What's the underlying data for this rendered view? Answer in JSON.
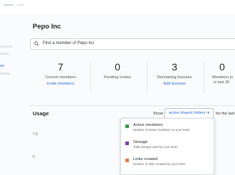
{
  "sidebar": {
    "link_fragment": "on"
  },
  "org": {
    "name": "Pepo Inc"
  },
  "search": {
    "placeholder": "Find a member of Pepo Inc"
  },
  "stats": [
    {
      "number": "7",
      "label": "Current members",
      "link": "Invite members"
    },
    {
      "number": "0",
      "label": "Pending invites",
      "link": ""
    },
    {
      "number": "3",
      "label": "Remaining licenses",
      "link": "Add licenses"
    },
    {
      "number": "0",
      "label": "Members jo",
      "link": "in last 30"
    }
  ],
  "usage": {
    "title": "Usage",
    "show_label": "Show",
    "selected": "active shared folders",
    "period_label": "for the last",
    "y_ticks": [
      "7.5",
      "5"
    ]
  },
  "dropdown": {
    "options": [
      {
        "title": "Active members",
        "desc": "Number of active members on your team",
        "color": "#3a9a4a"
      },
      {
        "title": "Storage",
        "desc": "Total storage used by your team",
        "color": "#7b3fa0"
      },
      {
        "title": "Links created",
        "desc": "Number of links created by your team",
        "color": "#e07a4a"
      }
    ]
  }
}
